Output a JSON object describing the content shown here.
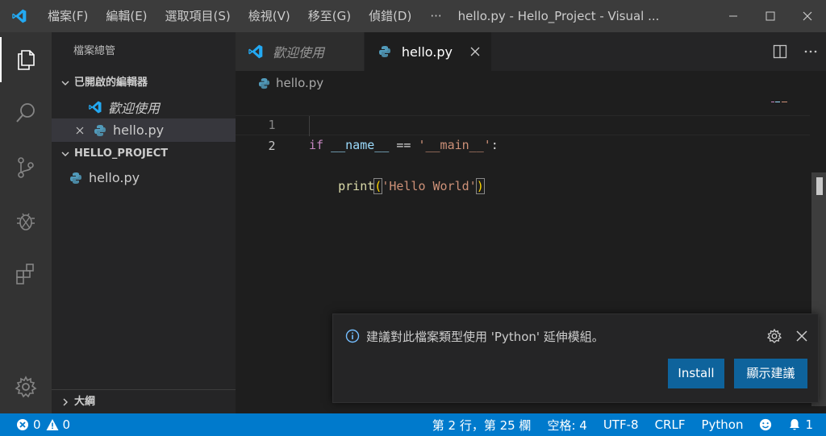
{
  "titlebar": {
    "menus": [
      "檔案(F)",
      "編輯(E)",
      "選取項目(S)",
      "檢視(V)",
      "移至(G)",
      "偵錯(D)"
    ],
    "more": "···",
    "window_title": "hello.py - Hello_Project - Visual ..."
  },
  "sidebar": {
    "title": "檔案總管",
    "open_editors": {
      "header": "已開啟的編輯器",
      "items": [
        {
          "label": "歡迎使用",
          "icon": "vscode-icon"
        },
        {
          "label": "hello.py",
          "icon": "python-icon"
        }
      ]
    },
    "project": {
      "header": "HELLO_PROJECT",
      "files": [
        {
          "label": "hello.py",
          "icon": "python-icon"
        }
      ]
    },
    "outline": {
      "header": "大綱"
    }
  },
  "editor": {
    "tabs": [
      {
        "label": "歡迎使用",
        "icon": "vscode-icon",
        "active": false
      },
      {
        "label": "hello.py",
        "icon": "python-icon",
        "active": true
      }
    ],
    "breadcrumb": "hello.py",
    "lines": [
      {
        "number": "1",
        "tokens": [
          "if",
          "__name__",
          "==",
          "'__main__'",
          ":"
        ]
      },
      {
        "number": "2",
        "tokens": [
          "print",
          "(",
          "'Hello World'",
          ")"
        ]
      }
    ]
  },
  "notification": {
    "icon": "info-icon",
    "message": "建議對此檔案類型使用 'Python' 延伸模組。",
    "install_label": "Install",
    "show_label": "顯示建議"
  },
  "statusbar": {
    "errors": "0",
    "warnings": "0",
    "position": "第 2 行，第 25 欄",
    "spaces": "空格: 4",
    "encoding": "UTF-8",
    "eol": "CRLF",
    "language": "Python",
    "notifications": "1"
  },
  "colors": {
    "accent": "#007acc",
    "button": "#0e639c",
    "titlebar": "#3c3c3c",
    "activitybar": "#333333",
    "sidebar": "#252526",
    "editor": "#1e1e1e"
  }
}
